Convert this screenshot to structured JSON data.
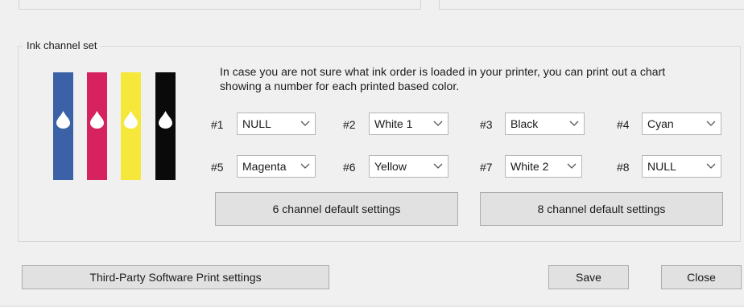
{
  "group": {
    "title": "Ink channel set"
  },
  "info_text": "In case you are not sure what ink order is loaded in your printer, you can print out a chart\nshowing a number for each printed based color.",
  "ink_colors": [
    "#3b62a6",
    "#d6235f",
    "#f5e83a",
    "#0a0a0a"
  ],
  "channels": [
    {
      "label": "#1",
      "value": "NULL"
    },
    {
      "label": "#2",
      "value": "White 1"
    },
    {
      "label": "#3",
      "value": "Black"
    },
    {
      "label": "#4",
      "value": "Cyan"
    },
    {
      "label": "#5",
      "value": "Magenta"
    },
    {
      "label": "#6",
      "value": "Yellow"
    },
    {
      "label": "#7",
      "value": "White 2"
    },
    {
      "label": "#8",
      "value": "NULL"
    }
  ],
  "buttons": {
    "six_channel": "6 channel default settings",
    "eight_channel": "8 channel default settings",
    "third_party": "Third-Party Software Print settings",
    "save": "Save",
    "close": "Close"
  }
}
